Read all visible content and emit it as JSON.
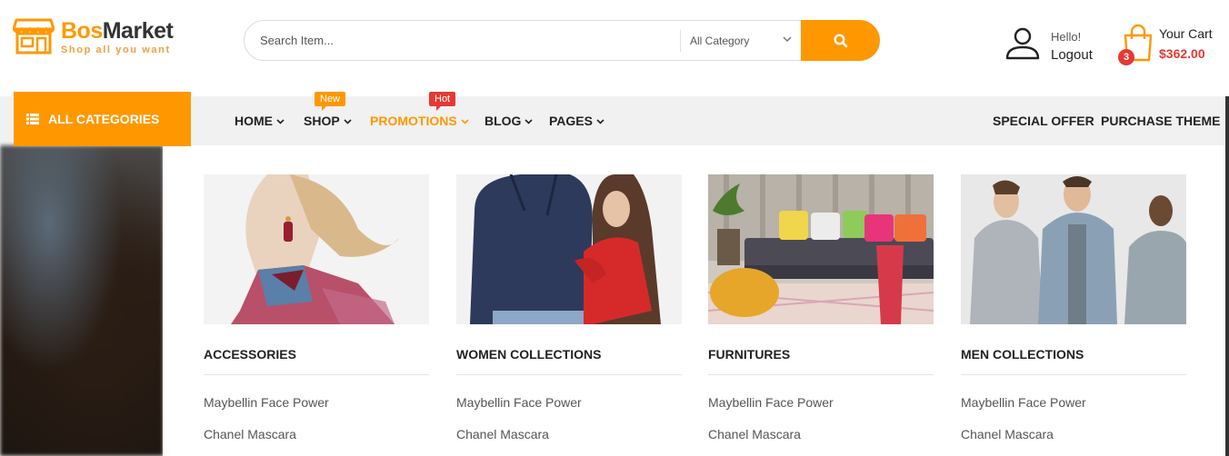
{
  "brand": {
    "name_part1": "Bos",
    "name_part2": "Market",
    "tagline": "Shop all you want",
    "primary_color": "#ff9800",
    "dark_color": "#333333",
    "alert_color": "#e53935"
  },
  "search": {
    "placeholder": "Search Item...",
    "category_selected": "All Category",
    "button_icon": "search-icon"
  },
  "account": {
    "greeting": "Hello!",
    "action": "Logout",
    "icon": "user-icon"
  },
  "cart": {
    "title": "Your Cart",
    "total": "$362.00",
    "count": "3",
    "icon": "shopping-bag-icon"
  },
  "nav": {
    "all_categories": "ALL CATEGORIES",
    "items": [
      {
        "label": "HOME"
      },
      {
        "label": "SHOP",
        "badge": "New"
      },
      {
        "label": "PROMOTIONS",
        "badge": "Hot"
      },
      {
        "label": "BLOG"
      },
      {
        "label": "PAGES"
      }
    ],
    "right_items": [
      {
        "label": "SPECIAL OFFER"
      },
      {
        "label": "PURCHASE THEME"
      }
    ]
  },
  "mega_menu": {
    "columns": [
      {
        "title": "ACCESSORIES",
        "links": [
          "Maybellin Face Power",
          "Chanel Mascara"
        ]
      },
      {
        "title": "WOMEN COLLECTIONS",
        "links": [
          "Maybellin Face Power",
          "Chanel Mascara"
        ]
      },
      {
        "title": "FURNITURES",
        "links": [
          "Maybellin Face Power",
          "Chanel Mascara"
        ]
      },
      {
        "title": "MEN COLLECTIONS",
        "links": [
          "Maybellin Face Power",
          "Chanel Mascara"
        ]
      }
    ]
  }
}
